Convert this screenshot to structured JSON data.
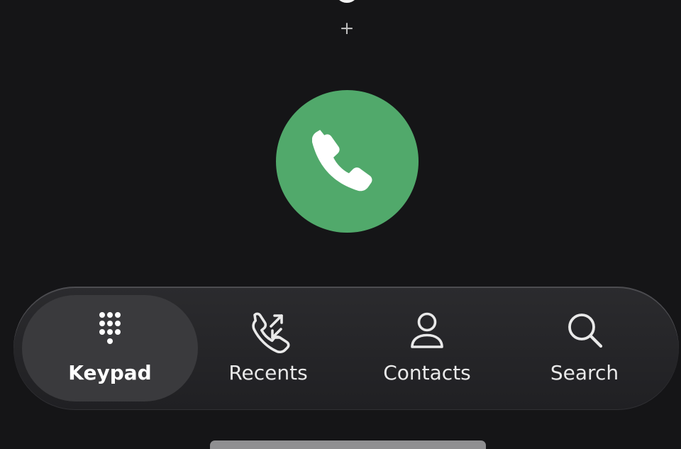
{
  "dialer": {
    "plus_label": "+",
    "call_icon": "phone-icon",
    "call_color": "#51a96b"
  },
  "bottom_nav": {
    "items": [
      {
        "label": "Keypad",
        "icon": "keypad-icon",
        "active": true
      },
      {
        "label": "Recents",
        "icon": "recents-icon",
        "active": false
      },
      {
        "label": "Contacts",
        "icon": "contacts-icon",
        "active": false
      },
      {
        "label": "Search",
        "icon": "search-icon",
        "active": false
      }
    ]
  },
  "colors": {
    "background": "#151517",
    "nav_background": "#202023",
    "nav_active": "#3a3a3d",
    "text": "#e9e9e9",
    "home_indicator": "#8f8f91"
  }
}
